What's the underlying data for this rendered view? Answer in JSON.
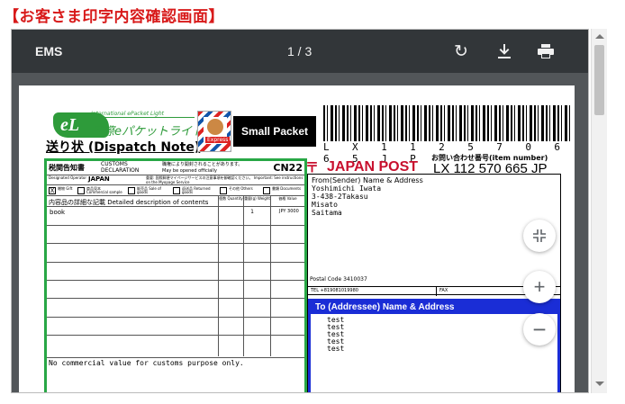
{
  "page_heading": "【お客さま印字内容確認画面】",
  "viewer": {
    "title": "EMS",
    "page_indicator": "1 / 3",
    "rotate_icon": "rotate-icon",
    "download_icon": "download-icon",
    "print_icon": "print-icon"
  },
  "zoom": {
    "fit_icon": "fit-to-page-icon",
    "zoom_in_label": "+",
    "zoom_out_label": "−"
  },
  "label": {
    "epacket_logo": "eL",
    "epacket_brand": "International ePacket Light",
    "epacket_jp": "国際eパケットライト",
    "dispatch_note": "送り状 (Dispatch Note)",
    "express_badge": "Express",
    "small_packet": "Small Packet",
    "barcode_text": "L X 1 1 2 5 7 0 6 6 5 J P",
    "inquiry_label": "お問い合わせ番号(item number)",
    "japan_post": "JAPAN POST",
    "tracking_number": "LX 112 570 665 JP",
    "cn22": {
      "title_jp": "税関告知書",
      "customs": "CUSTOMS",
      "declaration": "DECLARATION",
      "official_note_jp": "職権により開封されることがあります。",
      "official_note_en": "May be opened officially",
      "code": "CN22",
      "designated_operator": "Designated Operator",
      "country": "JAPAN",
      "important_note": "重要: 国際郵便マイページサービスの注意事項を御確認ください。 Important: See instructions on the Myopage Service",
      "categories": [
        {
          "label": "贈物 Gift",
          "checked": true
        },
        {
          "label": "商品見本 Commercial sample",
          "checked": false
        },
        {
          "label": "販売品 Sale of goods",
          "checked": false
        },
        {
          "label": "返送品 Returned goods",
          "checked": false
        },
        {
          "label": "その他 Others",
          "checked": false
        },
        {
          "label": "書類 Documents",
          "checked": false
        }
      ],
      "detail_header": "内容品の詳細な記載 Detailed description of contents",
      "qty_header": "個数 Quantity",
      "weight_header": "重量(g) Weight",
      "value_header": "価格 Value",
      "items": [
        {
          "description": "book",
          "quantity": "1",
          "value": "JPY 3000"
        }
      ],
      "no_commercial": "No commercial value for customs purpose only."
    },
    "sender": {
      "header": "From(Sender) Name & Address",
      "lines": [
        "Yoshimichi Iwata",
        "3-438-2Takasu",
        "Misato",
        "Saitama"
      ],
      "postal_code": "Postal Code 3410037",
      "tel": "TEL +819081019980",
      "fax": "FAX"
    },
    "addressee": {
      "header": "To (Addressee) Name & Address",
      "lines": [
        "test",
        "test",
        "test",
        "test",
        "test"
      ]
    }
  }
}
